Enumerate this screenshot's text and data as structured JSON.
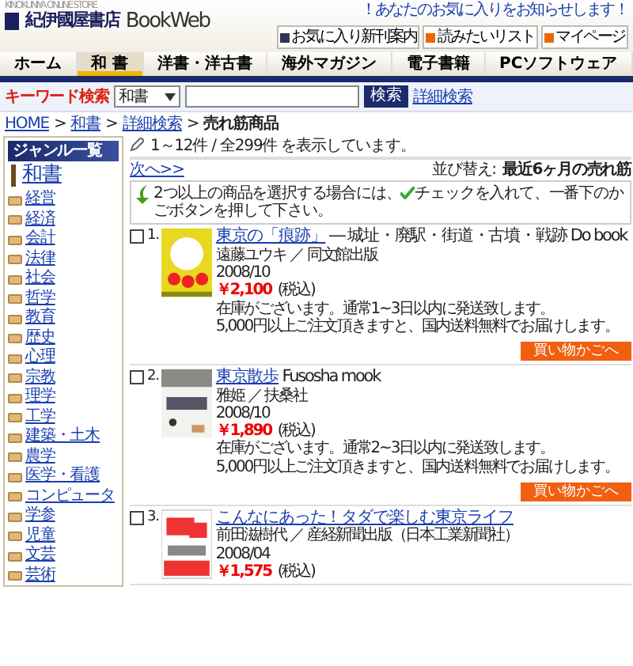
{
  "header": {
    "store_label": "KINOKUNIYA ONLINE STORE",
    "logo_jp": "紀伊國屋書店",
    "logo_en": "BookWeb",
    "notice": "！あなたのお気に入りをお知らせします！",
    "buttons": [
      "お気に入り新刊案内",
      "読みたいリスト",
      "マイページ"
    ]
  },
  "tabs": [
    {
      "label": "ホーム",
      "selected": false
    },
    {
      "label": "和 書",
      "selected": true
    },
    {
      "label": "洋書・洋古書",
      "selected": false
    },
    {
      "label": "海外マガジン",
      "selected": false
    },
    {
      "label": "電子書籍",
      "selected": false
    },
    {
      "label": "PCソフトウェア",
      "selected": false
    }
  ],
  "search": {
    "label": "キーワード検索",
    "category": "和書",
    "button": "検索",
    "advanced_link": "詳細検索"
  },
  "breadcrumb": {
    "separator": ">",
    "items": [
      "HOME",
      "和書",
      "詳細検索",
      "売れ筋商品"
    ]
  },
  "sidebar": {
    "title": "ジャンル一覧",
    "heading": "和書",
    "items": [
      "経営",
      "経済",
      "会計",
      "法律",
      "社会",
      "哲学",
      "教育",
      "歴史",
      "心理",
      "宗教",
      "理学",
      "工学",
      "建築・土木",
      "農学",
      "医学・看護",
      "コンピュータ",
      "学参",
      "児童",
      "文芸",
      "芸術"
    ]
  },
  "results": {
    "count": "1～12件 / 全299件 を表示しています。",
    "next": "次へ>>",
    "sort_label": "並び替え:",
    "sort_value": "最近6ヶ月の売れ筋",
    "notice_before": "2つ以上の商品を選択する場合には、",
    "notice_after": "チェックを入れて、一番下のかごボタンを押して下さい。"
  },
  "products": [
    {
      "number": "1.",
      "checked": false,
      "title_link": "東京の「痕跡」",
      "title_rest": "― 城址・廃駅・街道・古墳・戦跡 Do book",
      "author": "遠藤ユウキ ／ 同文館出版",
      "date": "2008/10",
      "price": "￥2,100",
      "tax": "(税込)",
      "stock": "在庫がございます。通常1~3日以内に発送致します。",
      "shipping": "5,000円以上ご注文頂きますと、国内送料無料でお届けします。",
      "cart_button": "買い物かごへ"
    },
    {
      "number": "2.",
      "checked": false,
      "title_link": "東京散歩",
      "title_rest": "Fusosha mook",
      "author": "雅姫 ／ 扶桑社",
      "date": "2008/10",
      "price": "￥1,890",
      "tax": "(税込)",
      "stock": "在庫がございます。通常2~3日以内に発送致します。",
      "shipping": "5,000円以上ご注文頂きますと、国内送料無料でお届けします。",
      "cart_button": "買い物かごへ"
    },
    {
      "number": "3.",
      "checked": false,
      "title_link": "こんなにあった！タダで楽しむ東京ライフ",
      "author": "前田滋樹代 ／ 産経新聞出版（日本工業新聞社）",
      "date": "2008/04",
      "price": "￥1,575",
      "tax": "(税込)"
    }
  ]
}
